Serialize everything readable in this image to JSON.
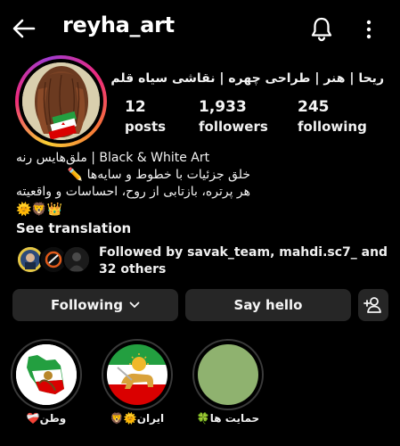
{
  "header": {
    "username": "reyha_art",
    "back_icon": "arrow-left-icon",
    "bell_icon": "bell-icon",
    "more_icon": "more-vertical-icon"
  },
  "profile": {
    "full_name": "ریحا | هنر | طراحی چهره | نقاشی سیاه قلم",
    "stats": [
      {
        "value": "12",
        "label": "posts"
      },
      {
        "value": "1,933",
        "label": "followers"
      },
      {
        "value": "245",
        "label": "following"
      }
    ]
  },
  "bio": {
    "lines": [
      "هنر سیاه‌قلم | Black & White Art",
      "خلق جزئیات با خطوط و سایه‌ها ✏️",
      "هر پرتره، بازتابی از روح، احساسات و واقعیته",
      "🌞🦁👑"
    ],
    "see_translation": "See translation"
  },
  "followed_by": {
    "text": "Followed by savak_team, mahdi.sc7_ and 32 others"
  },
  "actions": {
    "following_label": "Following",
    "say_hello_label": "Say hello",
    "add_user_icon": "add-user-icon"
  },
  "highlights": [
    {
      "label": "وطن❤️‍🩹"
    },
    {
      "label": "ایران🌞🦁"
    },
    {
      "label": "حمایت ها🍀"
    }
  ],
  "colors": {
    "background": "#000000",
    "button_bg": "#262626",
    "highlight_green": "#8fb26f",
    "flag_green": "#239f40",
    "flag_red": "#da0000"
  }
}
